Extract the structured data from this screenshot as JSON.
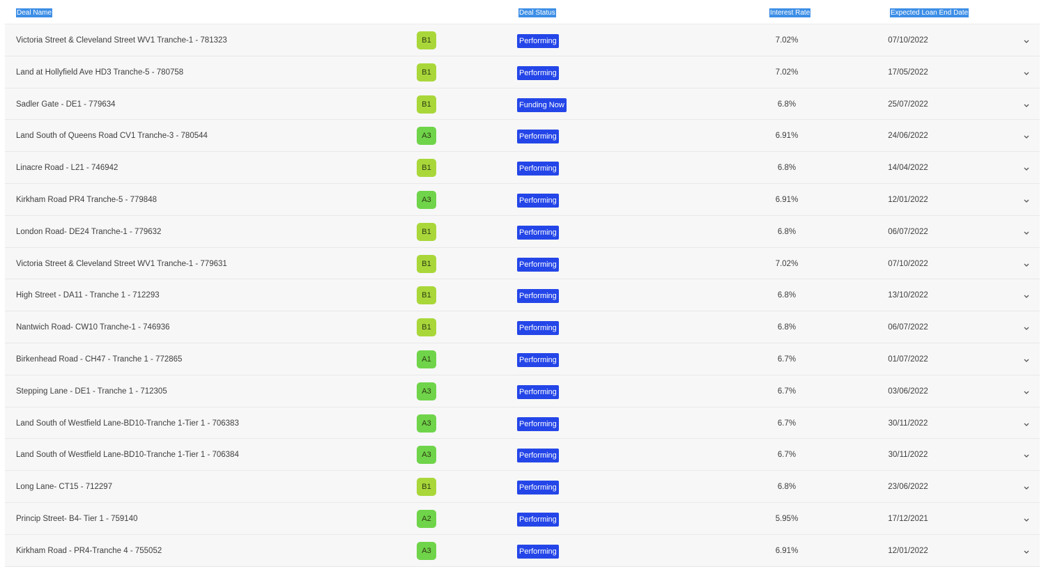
{
  "header": {
    "deal_name": "Deal Name",
    "deal_status": "Deal Status",
    "interest_rate": "Interest Rate",
    "expected_loan_end_date": "Expected Loan End Date"
  },
  "rows": [
    {
      "name": "Victoria Street & Cleveland Street WV1 Tranche-1 - 781323",
      "grade": "B1",
      "status": "Performing",
      "rate": "7.02%",
      "end_date": "07/10/2022"
    },
    {
      "name": "Land at Hollyfield Ave HD3 Tranche-5 - 780758",
      "grade": "B1",
      "status": "Performing",
      "rate": "7.02%",
      "end_date": "17/05/2022"
    },
    {
      "name": "Sadler Gate - DE1 - 779634",
      "grade": "B1",
      "status": "Funding Now",
      "rate": "6.8%",
      "end_date": "25/07/2022"
    },
    {
      "name": "Land South of Queens Road CV1 Tranche-3 - 780544",
      "grade": "A3",
      "status": "Performing",
      "rate": "6.91%",
      "end_date": "24/06/2022"
    },
    {
      "name": "Linacre Road - L21 - 746942",
      "grade": "B1",
      "status": "Performing",
      "rate": "6.8%",
      "end_date": "14/04/2022"
    },
    {
      "name": "Kirkham Road PR4 Tranche-5 - 779848",
      "grade": "A3",
      "status": "Performing",
      "rate": "6.91%",
      "end_date": "12/01/2022"
    },
    {
      "name": "London Road- DE24 Tranche-1 - 779632",
      "grade": "B1",
      "status": "Performing",
      "rate": "6.8%",
      "end_date": "06/07/2022"
    },
    {
      "name": "Victoria Street & Cleveland Street WV1 Tranche-1 - 779631",
      "grade": "B1",
      "status": "Performing",
      "rate": "7.02%",
      "end_date": "07/10/2022"
    },
    {
      "name": "High Street - DA11 - Tranche 1 - 712293",
      "grade": "B1",
      "status": "Performing",
      "rate": "6.8%",
      "end_date": "13/10/2022"
    },
    {
      "name": "Nantwich Road- CW10 Tranche-1 - 746936",
      "grade": "B1",
      "status": "Performing",
      "rate": "6.8%",
      "end_date": "06/07/2022"
    },
    {
      "name": "Birkenhead Road - CH47 - Tranche 1 - 772865",
      "grade": "A1",
      "status": "Performing",
      "rate": "6.7%",
      "end_date": "01/07/2022"
    },
    {
      "name": "Stepping Lane - DE1 - Tranche 1 - 712305",
      "grade": "A3",
      "status": "Performing",
      "rate": "6.7%",
      "end_date": "03/06/2022"
    },
    {
      "name": "Land South of Westfield Lane-BD10-Tranche 1-Tier 1 - 706383",
      "grade": "A3",
      "status": "Performing",
      "rate": "6.7%",
      "end_date": "30/11/2022"
    },
    {
      "name": "Land South of Westfield Lane-BD10-Tranche 1-Tier 1 - 706384",
      "grade": "A3",
      "status": "Performing",
      "rate": "6.7%",
      "end_date": "30/11/2022"
    },
    {
      "name": "Long Lane- CT15 - 712297",
      "grade": "B1",
      "status": "Performing",
      "rate": "6.8%",
      "end_date": "23/06/2022"
    },
    {
      "name": "Princip Street- B4- Tier 1 - 759140",
      "grade": "A2",
      "status": "Performing",
      "rate": "5.95%",
      "end_date": "17/12/2021"
    },
    {
      "name": "Kirkham Road - PR4-Tranche 4 - 755052",
      "grade": "A3",
      "status": "Performing",
      "rate": "6.91%",
      "end_date": "12/01/2022"
    }
  ],
  "colors": {
    "grade_b": "#a9d73a",
    "grade_a": "#6fd44a",
    "status_badge": "#2446e8",
    "header_selection": "#3d8ee6"
  },
  "icons": {
    "row_toggle": "chevron-down-icon"
  }
}
